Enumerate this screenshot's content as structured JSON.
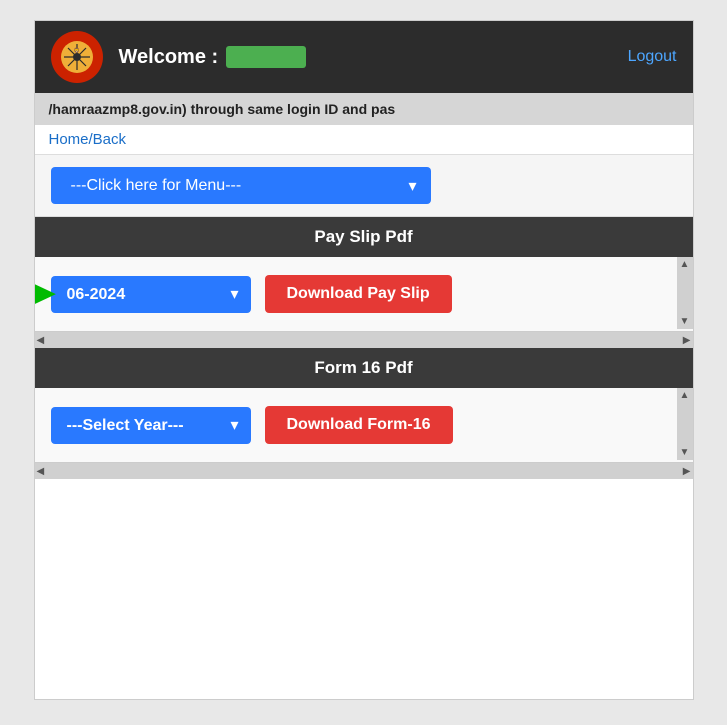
{
  "header": {
    "welcome_text": "Welcome :",
    "logout_label": "Logout"
  },
  "notice": {
    "text": "/hamraazmp8.gov.in) through same login ID and pas"
  },
  "nav": {
    "home_back_label": "Home/Back"
  },
  "menu": {
    "placeholder": "---Click here for Menu---"
  },
  "payslip_section": {
    "title": "Pay Slip Pdf",
    "month_value": "06-2024",
    "download_label": "Download Pay Slip"
  },
  "form16_section": {
    "title": "Form 16 Pdf",
    "year_placeholder": "---Select Year---",
    "download_label": "Download Form-16"
  }
}
